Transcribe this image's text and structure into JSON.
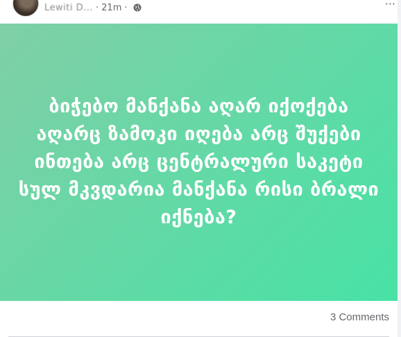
{
  "post": {
    "author": "Lewiti D...",
    "separator": "·",
    "time": "21m",
    "separator2": "·",
    "privacy_icon": "globe-icon",
    "more_icon": "more-icon",
    "text": "ბიჭებო მანქანა აღარ იქოქება აღარც ზამოკი იღება არც შუქები ინთება არც ცენტრალური საკეტი სულ მკვდარია მანქანა რისი ბრალი იქნება?",
    "background": {
      "from": "#80cfa6",
      "to": "#48e2a6",
      "text_color": "#ffffff"
    }
  },
  "footer": {
    "comments_label": "3 Comments"
  }
}
